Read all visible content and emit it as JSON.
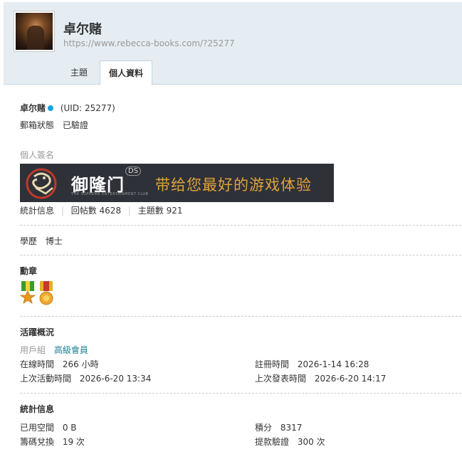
{
  "header": {
    "username": "卓尔赌",
    "url": "https://www.rebecca-books.com/?25277",
    "tabs": [
      {
        "label": "主題"
      },
      {
        "label": "個人資料"
      }
    ]
  },
  "profile": {
    "name": "卓尔赌",
    "uid": "(UID: 25277)",
    "email_status_label": "郵箱狀態",
    "email_status_value": "已驗證",
    "signature_label": "個人簽名",
    "signature_banner": {
      "brand": "御隆门",
      "sub": "THE SUPREME ENTERTAINMENT CLUB",
      "badge": "DS",
      "slogan": "带给您最好的游戏体验"
    },
    "stats_line": {
      "label": "統計信息",
      "replies": "回帖數 4628",
      "topics": "主題數 921"
    },
    "education_label": "學歷",
    "education_value": "博士"
  },
  "medals": {
    "title": "勳章",
    "items": [
      "medal-green-icon",
      "medal-red-icon"
    ]
  },
  "activity": {
    "title": "活躍概況",
    "group_label": "用戶組",
    "group_value": "高級會員",
    "online_label": "在線時間",
    "online_value": "266 小時",
    "reg_label": "註冊時間",
    "reg_value": "2026-1-14 16:28",
    "last_active_label": "上次活動時間",
    "last_active_value": "2026-6-20 13:34",
    "last_post_label": "上次發表時間",
    "last_post_value": "2026-6-20 14:17"
  },
  "stats": {
    "title": "統計信息",
    "space_label": "已用空間",
    "space_value": "0 B",
    "points_label": "積分",
    "points_value": "8317",
    "exchange_label": "籌碼兌換",
    "exchange_value": "19 次",
    "withdraw_label": "提款驗證",
    "withdraw_value": "300 次"
  },
  "colors": {
    "header_bg": "#e5edf2",
    "accent_dot": "#19a2de",
    "group_color": "#1a7f8f"
  }
}
